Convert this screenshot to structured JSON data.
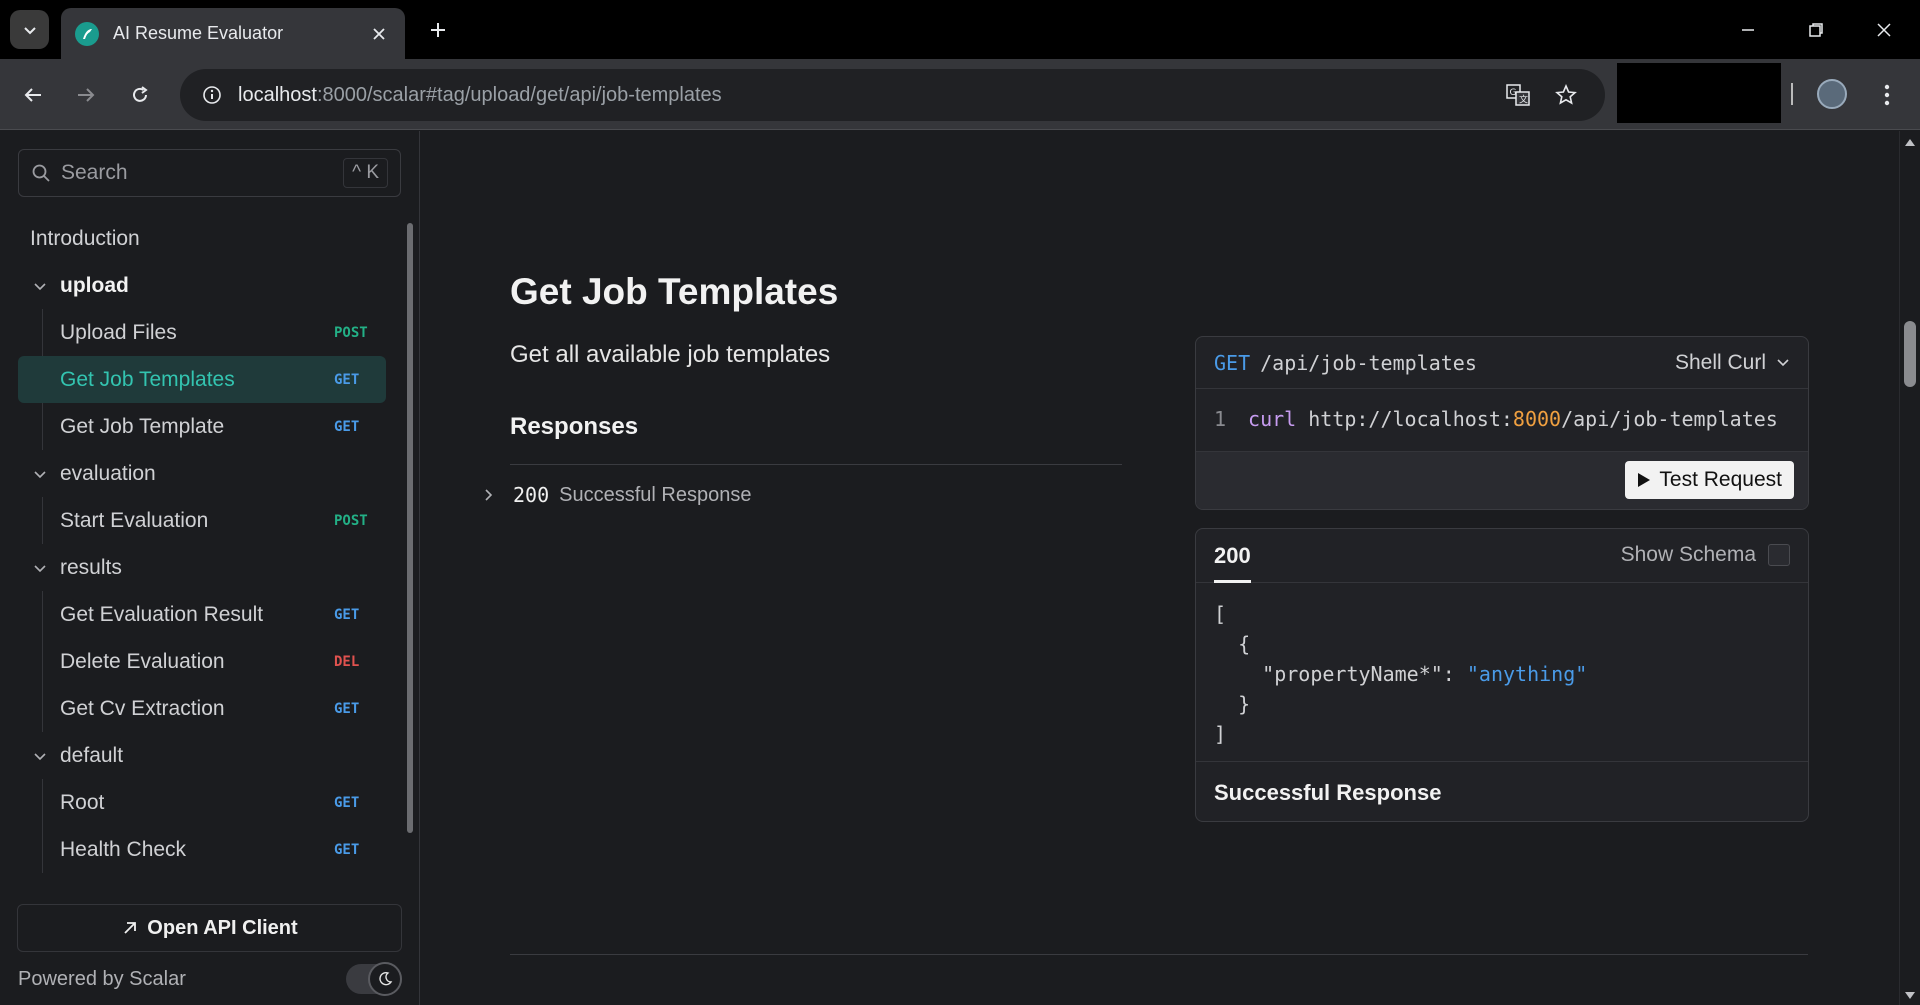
{
  "browser": {
    "tab_title": "AI Resume Evaluator",
    "url_host": "localhost",
    "url_rest": ":8000/scalar#tag/upload/get/api/job-templates"
  },
  "sidebar": {
    "search_placeholder": "Search",
    "search_shortcut": "^ K",
    "introduction": "Introduction",
    "groups": [
      {
        "name": "upload",
        "items": [
          {
            "label": "Upload Files",
            "method": "POST"
          },
          {
            "label": "Get Job Templates",
            "method": "GET",
            "active": true
          },
          {
            "label": "Get Job Template",
            "method": "GET"
          }
        ]
      },
      {
        "name": "evaluation",
        "items": [
          {
            "label": "Start Evaluation",
            "method": "POST"
          }
        ]
      },
      {
        "name": "results",
        "items": [
          {
            "label": "Get Evaluation Result",
            "method": "GET"
          },
          {
            "label": "Delete Evaluation",
            "method": "DEL"
          },
          {
            "label": "Get Cv Extraction",
            "method": "GET"
          }
        ]
      },
      {
        "name": "default",
        "items": [
          {
            "label": "Root",
            "method": "GET"
          },
          {
            "label": "Health Check",
            "method": "GET"
          }
        ]
      }
    ],
    "open_client_label": "Open API Client",
    "powered_by": "Powered by Scalar"
  },
  "main": {
    "title": "Get Job Templates",
    "description": "Get all available job templates",
    "responses_heading": "Responses",
    "response_code": "200",
    "response_desc": "Successful Response"
  },
  "request_card": {
    "method": "GET",
    "path": "/api/job-templates",
    "language": "Shell Curl",
    "line_no": "1",
    "cmd": "curl",
    "url_a": "http://localhost:",
    "url_port": "8000",
    "url_b": "/api/job-templates",
    "test_label": "Test Request"
  },
  "response_card": {
    "tab": "200",
    "show_schema": "Show Schema",
    "json_line1": "[",
    "json_line2": "  {",
    "json_key": "    \"propertyName*\": ",
    "json_value": "\"anything\"",
    "json_line4": "  }",
    "json_line5": "]",
    "footer": "Successful Response"
  },
  "colors": {
    "accent": "#33c4b0",
    "get": "#4a9be8",
    "post": "#23b086",
    "delete": "#e0524f"
  }
}
